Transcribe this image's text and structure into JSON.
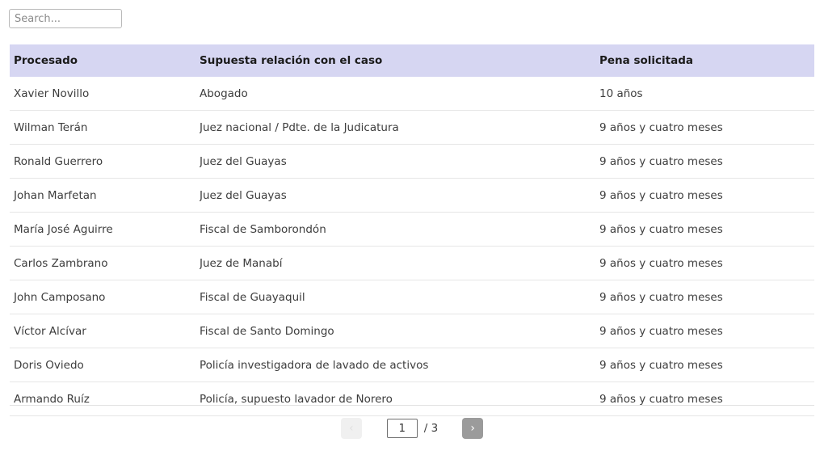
{
  "search": {
    "placeholder": "Search...",
    "value": ""
  },
  "table": {
    "columns": [
      "Procesado",
      "Supuesta relación con el caso",
      "Pena solicitada"
    ],
    "rows": [
      {
        "procesado": "Xavier Novillo",
        "relacion": "Abogado",
        "pena": "10 años"
      },
      {
        "procesado": "Wilman Terán",
        "relacion": "Juez nacional / Pdte. de la Judicatura",
        "pena": "9 años y cuatro meses"
      },
      {
        "procesado": "Ronald Guerrero",
        "relacion": "Juez del Guayas",
        "pena": "9 años y cuatro meses"
      },
      {
        "procesado": "Johan Marfetan",
        "relacion": "Juez del Guayas",
        "pena": "9 años y cuatro meses"
      },
      {
        "procesado": "María José Aguirre",
        "relacion": "Fiscal de Samborondón",
        "pena": "9 años y cuatro meses"
      },
      {
        "procesado": "Carlos Zambrano",
        "relacion": "Juez de Manabí",
        "pena": "9 años y cuatro meses"
      },
      {
        "procesado": "John Camposano",
        "relacion": "Fiscal de Guayaquil",
        "pena": "9 años y cuatro meses"
      },
      {
        "procesado": "Víctor Alcívar",
        "relacion": "Fiscal de Santo Domingo",
        "pena": "9 años y cuatro meses"
      },
      {
        "procesado": "Doris Oviedo",
        "relacion": "Policía investigadora de lavado de activos",
        "pena": "9 años y cuatro meses"
      },
      {
        "procesado": "Armando Ruíz",
        "relacion": "Policía, supuesto lavador de Norero",
        "pena": "9 años y cuatro meses"
      }
    ]
  },
  "pagination": {
    "prev_label": "‹",
    "next_label": "›",
    "current_page": "1",
    "total_label": "/ 3"
  },
  "colors": {
    "header_background": "#d6d6f2",
    "row_border": "#e6e6e6",
    "next_button": "#9b9b9b",
    "prev_button": "#f0f0f0",
    "text": "#3d3d3d"
  }
}
